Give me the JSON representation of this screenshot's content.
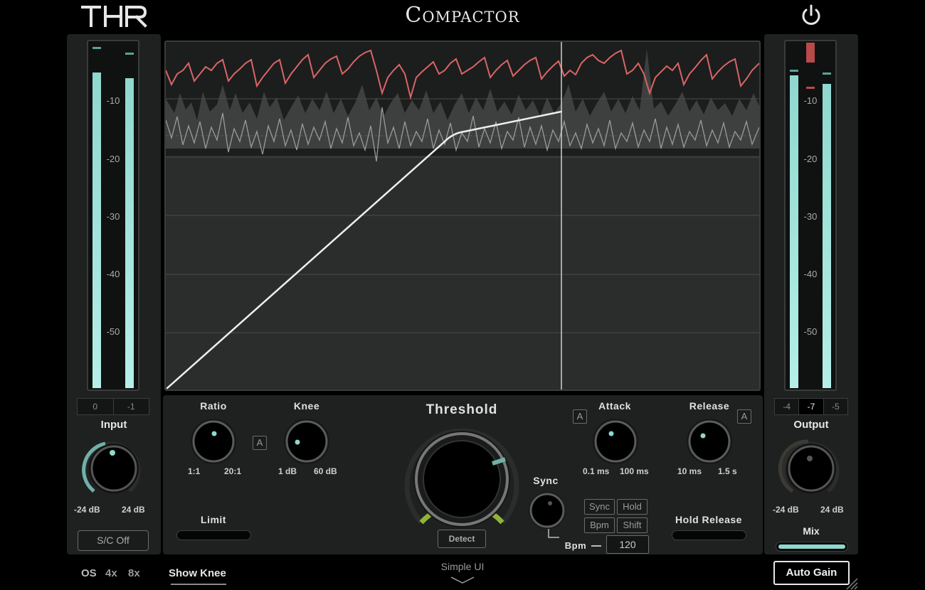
{
  "header": {
    "logo": "THR",
    "title": "Compactor",
    "power_icon": "power-icon"
  },
  "input": {
    "meter_ticks": [
      "-10",
      "-20",
      "-30",
      "-40",
      "-50"
    ],
    "meter_levels": [
      0.86,
      0.84
    ],
    "peak_values": [
      "0",
      "-1"
    ],
    "label": "Input",
    "min": "-24 dB",
    "max": "24 dB",
    "sc_button": "S/C Off"
  },
  "output": {
    "meter_ticks": [
      "-10",
      "-20",
      "-30",
      "-40",
      "-50"
    ],
    "meter_levels": [
      0.89,
      0.87
    ],
    "readout_values": [
      "-4",
      "-7",
      "-5"
    ],
    "label": "Output",
    "min": "-24 dB",
    "max": "24 dB",
    "mix_label": "Mix"
  },
  "controls": {
    "ratio": {
      "label": "Ratio",
      "min": "1:1",
      "max": "20:1"
    },
    "ratio_auto": "A",
    "knee": {
      "label": "Knee",
      "min": "1 dB",
      "max": "60 dB"
    },
    "threshold": {
      "label": "Threshold",
      "detect": "Detect"
    },
    "attack_auto": "A",
    "attack": {
      "label": "Attack",
      "min": "0.1 ms",
      "max": "100 ms"
    },
    "release": {
      "label": "Release",
      "min": "10 ms",
      "max": "1.5 s"
    },
    "release_auto": "A",
    "sync": {
      "label": "Sync"
    },
    "sync_buttons": [
      "Sync",
      "Hold",
      "Bpm",
      "Shift"
    ],
    "bpm_label": "Bpm",
    "bpm_value": "120",
    "limit_label": "Limit",
    "hold_release_label": "Hold Release"
  },
  "footer": {
    "os_label": "OS",
    "os_options": [
      "4x",
      "8x"
    ],
    "show_knee": "Show Knee",
    "simple_ui": "Simple UI",
    "auto_gain": "Auto Gain"
  },
  "colors": {
    "accent_teal": "#8fd8cf",
    "threshold_green": "#8fb33a",
    "envelope_red": "#d96565",
    "background": "#000000"
  }
}
